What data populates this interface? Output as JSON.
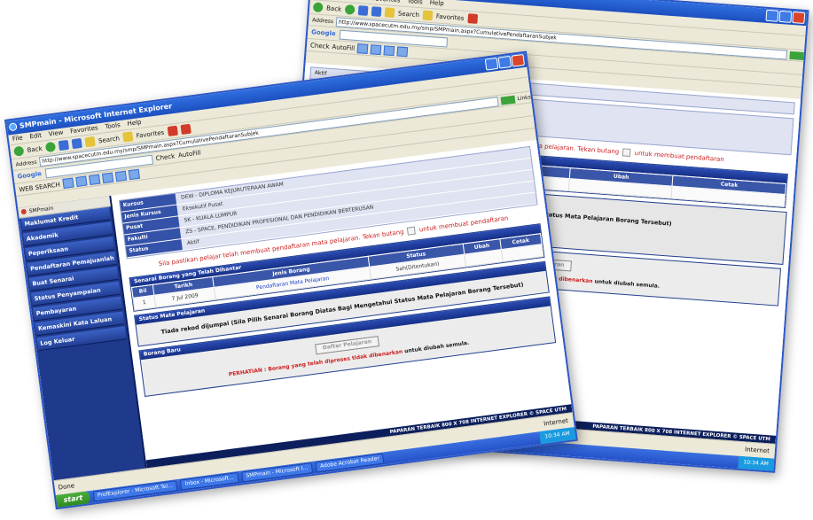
{
  "browser": {
    "title": "SMPmain - Microsoft Internet Explorer",
    "menu": [
      "File",
      "Edit",
      "View",
      "Favorites",
      "Tools",
      "Help"
    ],
    "toolbar": {
      "back": "Back",
      "search": "Search",
      "favorites": "Favorites"
    },
    "address_label": "Address",
    "address_url": "http://www.spacecutm.edu.my/smp/SMPmain.aspx?CumulativePendaftaranSubjek",
    "address_back": "http://www.spacecutm.edu.my/smp/SMPmain.aspx?CumulativePendaftaranSubjek",
    "go_label": "Go",
    "links_label": "Links",
    "google_logo": "Google",
    "google_search": "WEB SEARCH",
    "check_label": "Check",
    "autofill_label": "AutoFill",
    "status_left": "Done",
    "status_zone": "Internet",
    "tab_label": "SMPmain"
  },
  "sidebar": {
    "items": [
      "Maklumat Kredit",
      "Akademik",
      "Peperiksaan",
      "Pendaftaran Pemajuanlah",
      "Buat Senarai",
      "Status Penyampaian",
      "Pembayaran",
      "Kemaskini Kata Laluan",
      "Log Keluar"
    ]
  },
  "student": {
    "rows": [
      {
        "key": "Kursus",
        "value": "DEW - DIPLOMA KEJURUTERAAN AWAM"
      },
      {
        "key": "Jenis Kursus",
        "value": "Eksekutif Pusat"
      },
      {
        "key": "Pusat",
        "value": "SK - KUALA LUMPUR"
      },
      {
        "key": "Fakulti",
        "value": "ZS - SPACE, PENDIDIKAN PROFESIONAL DAN PENDIDIKAN BERTERUSAN"
      },
      {
        "key": "Status",
        "value": "Aktif"
      }
    ]
  },
  "notice": {
    "before": "Sila pastikan pelajar telah membuat pendaftaran mata pelajaran. Tekan butang",
    "after": "untuk membuat pendaftaran"
  },
  "senarai": {
    "header": "Senarai Borang yang Telah Dihantar",
    "columns": [
      "Bil",
      "Tarikh",
      "Jenis Borang",
      "Status",
      "Ubah",
      "Cetak"
    ],
    "rows": [
      {
        "bil": "1",
        "tarikh": "7 Jul 2009",
        "jenis": "Pendaftaran Mata Pelajaran",
        "status": "Sah(Ditentukan)",
        "ubah": "",
        "cetak": ""
      }
    ]
  },
  "status_mp": {
    "header": "Status Mata Pelajaran",
    "message": "Tiada rekod dijumpai (Sila Pilih Senarai Borang Diatas Bagi Mengetahui Status Mata Pelajaran Borang Tersebut)"
  },
  "borang_baru": {
    "header": "Borang Baru",
    "button": "Daftar Pelajaran",
    "note_prefix": "PERHATIAN : Borang yang telah diproses",
    "note_red": "tidak dibenarkan",
    "note_suffix": "untuk diubah semula."
  },
  "footer": "PAPARAN TERBAIK 800 X 708 INTERNET EXPLORER © SPACE UTM",
  "taskbar": {
    "start": "start",
    "tasks": [
      "ProfExplorer - Microsoft Tel...",
      "Inbox - Microsoft...",
      "SMPmain - Microsoft I...",
      "Adobe Acrobat Reader"
    ],
    "tray_time": "10:34 AM"
  }
}
